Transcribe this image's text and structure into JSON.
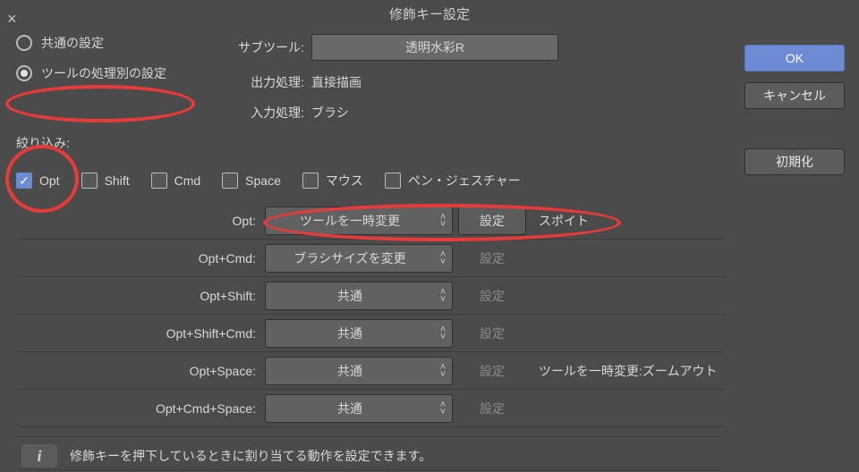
{
  "title": "修飾キー設定",
  "radios": {
    "common": "共通の設定",
    "per_tool": "ツールの処理別の設定"
  },
  "form": {
    "sub_tool_label": "サブツール:",
    "sub_tool_value": "透明水彩R",
    "output_label": "出力処理:",
    "output_value": "直接描画",
    "input_label": "入力処理:",
    "input_value": "ブラシ"
  },
  "filter_label": "絞り込み:",
  "filter": {
    "opt": "Opt",
    "shift": "Shift",
    "cmd": "Cmd",
    "space": "Space",
    "mouse": "マウス",
    "pen": "ペン・ジェスチャー"
  },
  "rows": [
    {
      "key": "Opt:",
      "combo": "ツールを一時変更",
      "set_enabled": true,
      "extra": "スポイト"
    },
    {
      "key": "Opt+Cmd:",
      "combo": "ブラシサイズを変更",
      "set_enabled": false,
      "extra": ""
    },
    {
      "key": "Opt+Shift:",
      "combo": "共通",
      "set_enabled": false,
      "extra": ""
    },
    {
      "key": "Opt+Shift+Cmd:",
      "combo": "共通",
      "set_enabled": false,
      "extra": ""
    },
    {
      "key": "Opt+Space:",
      "combo": "共通",
      "set_enabled": false,
      "extra": "ツールを一時変更:ズームアウト"
    },
    {
      "key": "Opt+Cmd+Space:",
      "combo": "共通",
      "set_enabled": false,
      "extra": ""
    }
  ],
  "set_label": "設定",
  "hint": "修飾キーを押下しているときに割り当てる動作を設定できます。",
  "buttons": {
    "ok": "OK",
    "cancel": "キャンセル",
    "reset": "初期化"
  }
}
